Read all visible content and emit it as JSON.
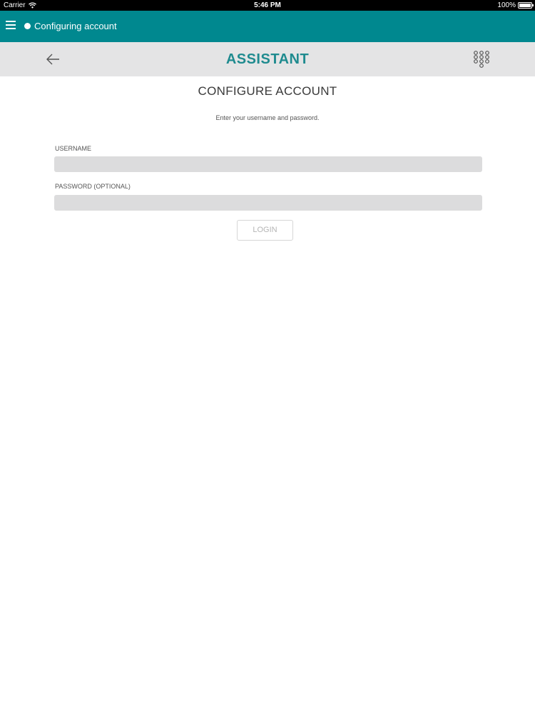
{
  "status_bar": {
    "carrier": "Carrier",
    "time": "5:46 PM",
    "battery_text": "100%",
    "battery_level": 1.0
  },
  "top_bar": {
    "title": "Configuring account",
    "background_color": "#00888f",
    "menu_icon": "hamburger-menu-icon",
    "status_icon": "status-dot-icon"
  },
  "header": {
    "title": "ASSISTANT",
    "title_color": "#1f8b8f",
    "back_icon": "back-arrow-icon",
    "dialer_icon": "dialpad-icon"
  },
  "form": {
    "title": "CONFIGURE ACCOUNT",
    "subtitle": "Enter your username and password.",
    "username_label": "USERNAME",
    "username_value": "",
    "password_label": "PASSWORD (OPTIONAL)",
    "password_value": "",
    "login_label": "LOGIN"
  }
}
